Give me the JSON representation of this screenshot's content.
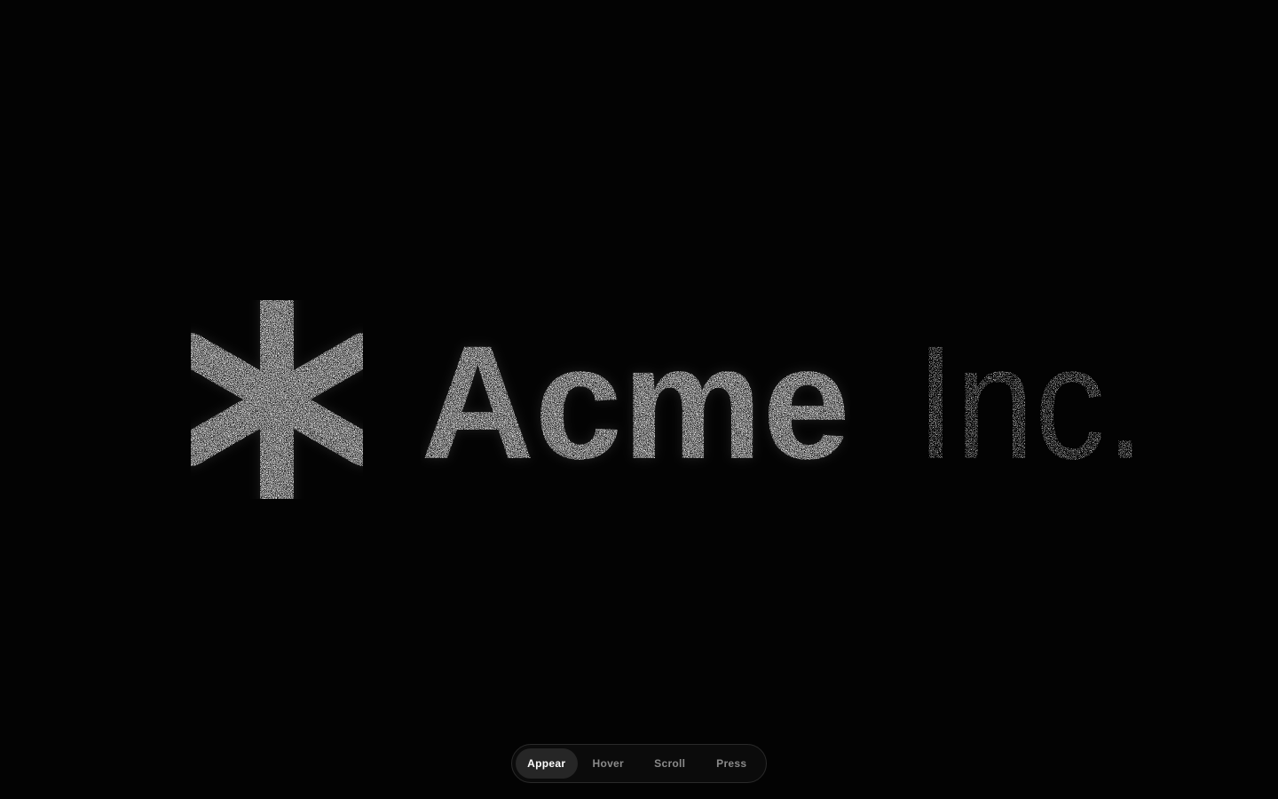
{
  "logo": {
    "text_primary": "Acme",
    "text_secondary": "Inc.",
    "icon": "asterisk-icon",
    "particle_color": "#f2f2f2"
  },
  "tabs": [
    {
      "label": "Appear",
      "active": true
    },
    {
      "label": "Hover",
      "active": false
    },
    {
      "label": "Scroll",
      "active": false
    },
    {
      "label": "Press",
      "active": false
    }
  ],
  "colors": {
    "background": "#030303",
    "tab_active_bg": "#262626",
    "tab_active_text": "#ffffff",
    "tab_inactive_text": "#8a8a8a"
  }
}
